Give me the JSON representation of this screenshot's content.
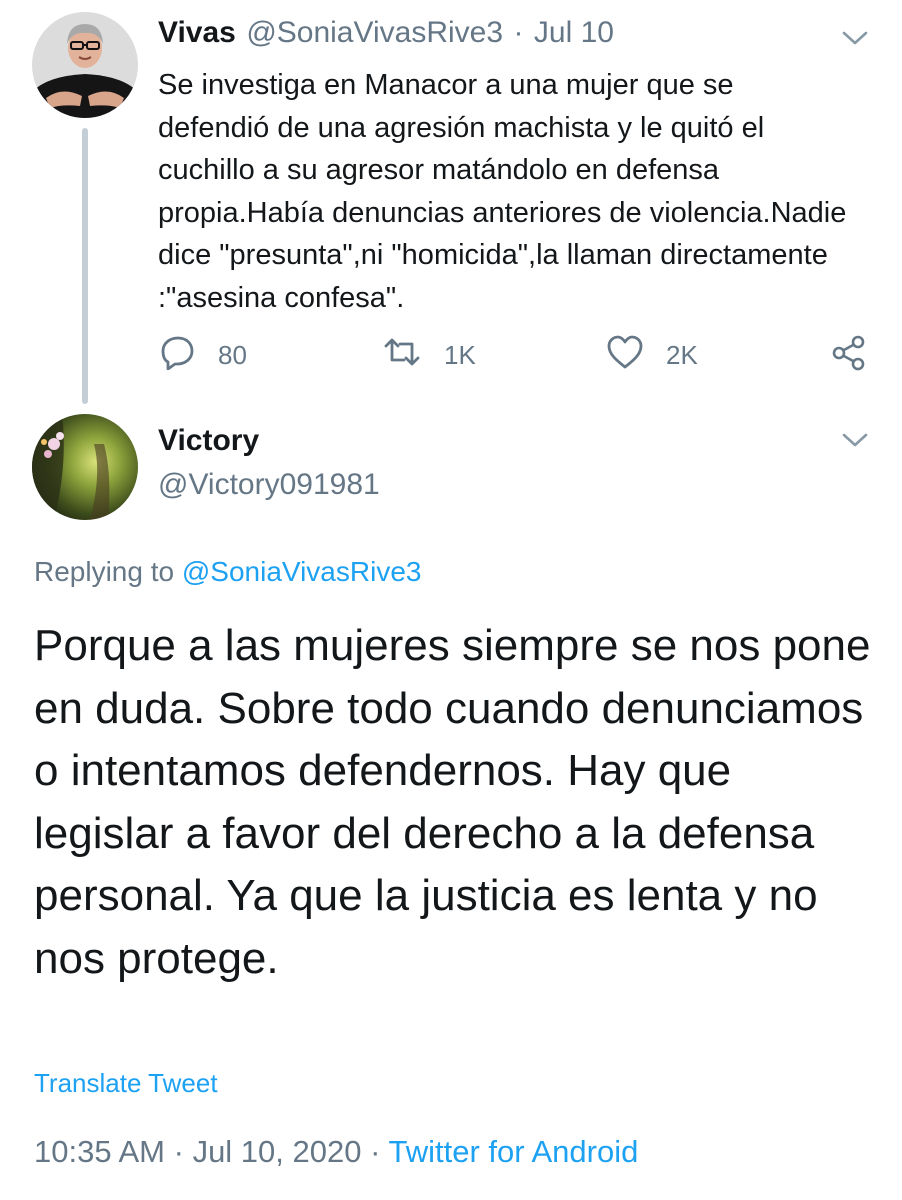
{
  "tweet": {
    "author_name": "Vivas",
    "author_handle": "@SoniaVivasRive3",
    "separator": "·",
    "date": "Jul 10",
    "text": "Se investiga en Manacor a una mujer que se defendió de una agresión machista y le quitó el cuchillo a su agresor matándolo en defensa propia.Había denuncias anteriores de violencia.Nadie dice \"presunta\",ni \"homicida\",la llaman directamente :\"asesina confesa\".",
    "replies": "80",
    "retweets": "1K",
    "likes": "2K"
  },
  "reply": {
    "author_name": "Victory",
    "author_handle": "@Victory091981",
    "replying_to_label": "Replying to",
    "replying_to_handle": "@SoniaVivasRive3",
    "text": "Porque a las mujeres siempre se nos pone en duda. Sobre todo cuando denunciamos o intentamos defendernos. Hay que legislar a favor del derecho a la defensa personal. Ya que la justicia es lenta y no nos protege.",
    "translate_label": "Translate Tweet",
    "time": "10:35 AM",
    "date": "Jul 10, 2020",
    "separator": "·",
    "source": "Twitter for Android"
  },
  "icons": {
    "reply": "reply-icon",
    "retweet": "retweet-icon",
    "like": "heart-icon",
    "share": "share-icon",
    "menu": "chevron-down-icon"
  },
  "colors": {
    "text": "#14171a",
    "secondary": "#657786",
    "link": "#1da1f2",
    "thread_line": "#c4ced6"
  }
}
